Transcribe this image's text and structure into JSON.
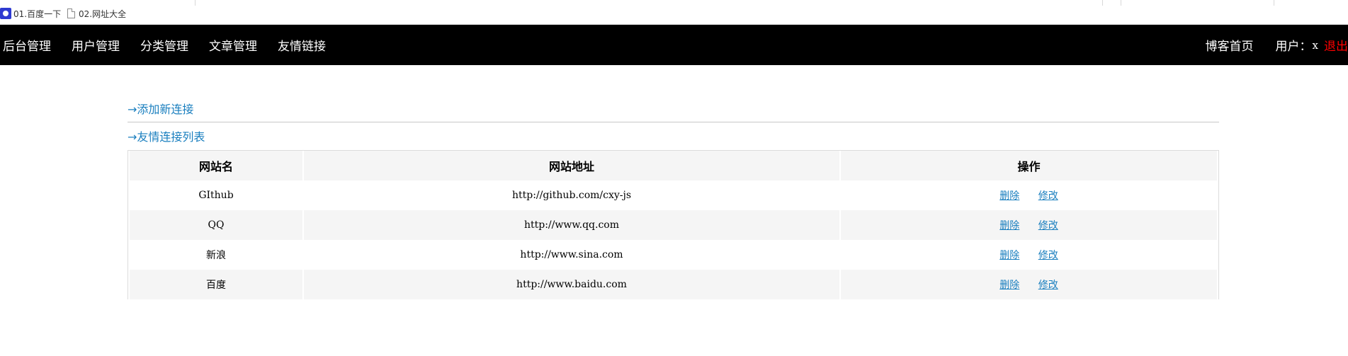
{
  "bookmarks": [
    {
      "label": "01.百度一下",
      "icon": "baidu-paw-icon"
    },
    {
      "label": "02.网址大全",
      "icon": "page-icon"
    }
  ],
  "nav": {
    "items": [
      "后台管理",
      "用户管理",
      "分类管理",
      "文章管理",
      "友情链接"
    ],
    "home": "博客首页",
    "user_label": "用户：",
    "user_name": "x",
    "logout": "退出"
  },
  "links_section": {
    "add_label": "→添加新连接",
    "list_label": "→友情连接列表"
  },
  "table": {
    "headers": [
      "网站名",
      "网站地址",
      "操作"
    ],
    "rows": [
      {
        "name": "GIthub",
        "url": "http://github.com/cxy-js",
        "delete": "删除",
        "edit": "修改"
      },
      {
        "name": "QQ",
        "url": "http://www.qq.com",
        "delete": "删除",
        "edit": "修改"
      },
      {
        "name": "新浪",
        "url": "http://www.sina.com",
        "delete": "删除",
        "edit": "修改"
      },
      {
        "name": "百度",
        "url": "http://www.baidu.com",
        "delete": "删除",
        "edit": "修改"
      }
    ]
  },
  "colors": {
    "nav_bg": "#000000",
    "nav_text": "#ffffff",
    "logout": "#ff0000",
    "link": "#1a7fbf",
    "stripe": "#f5f5f5"
  }
}
